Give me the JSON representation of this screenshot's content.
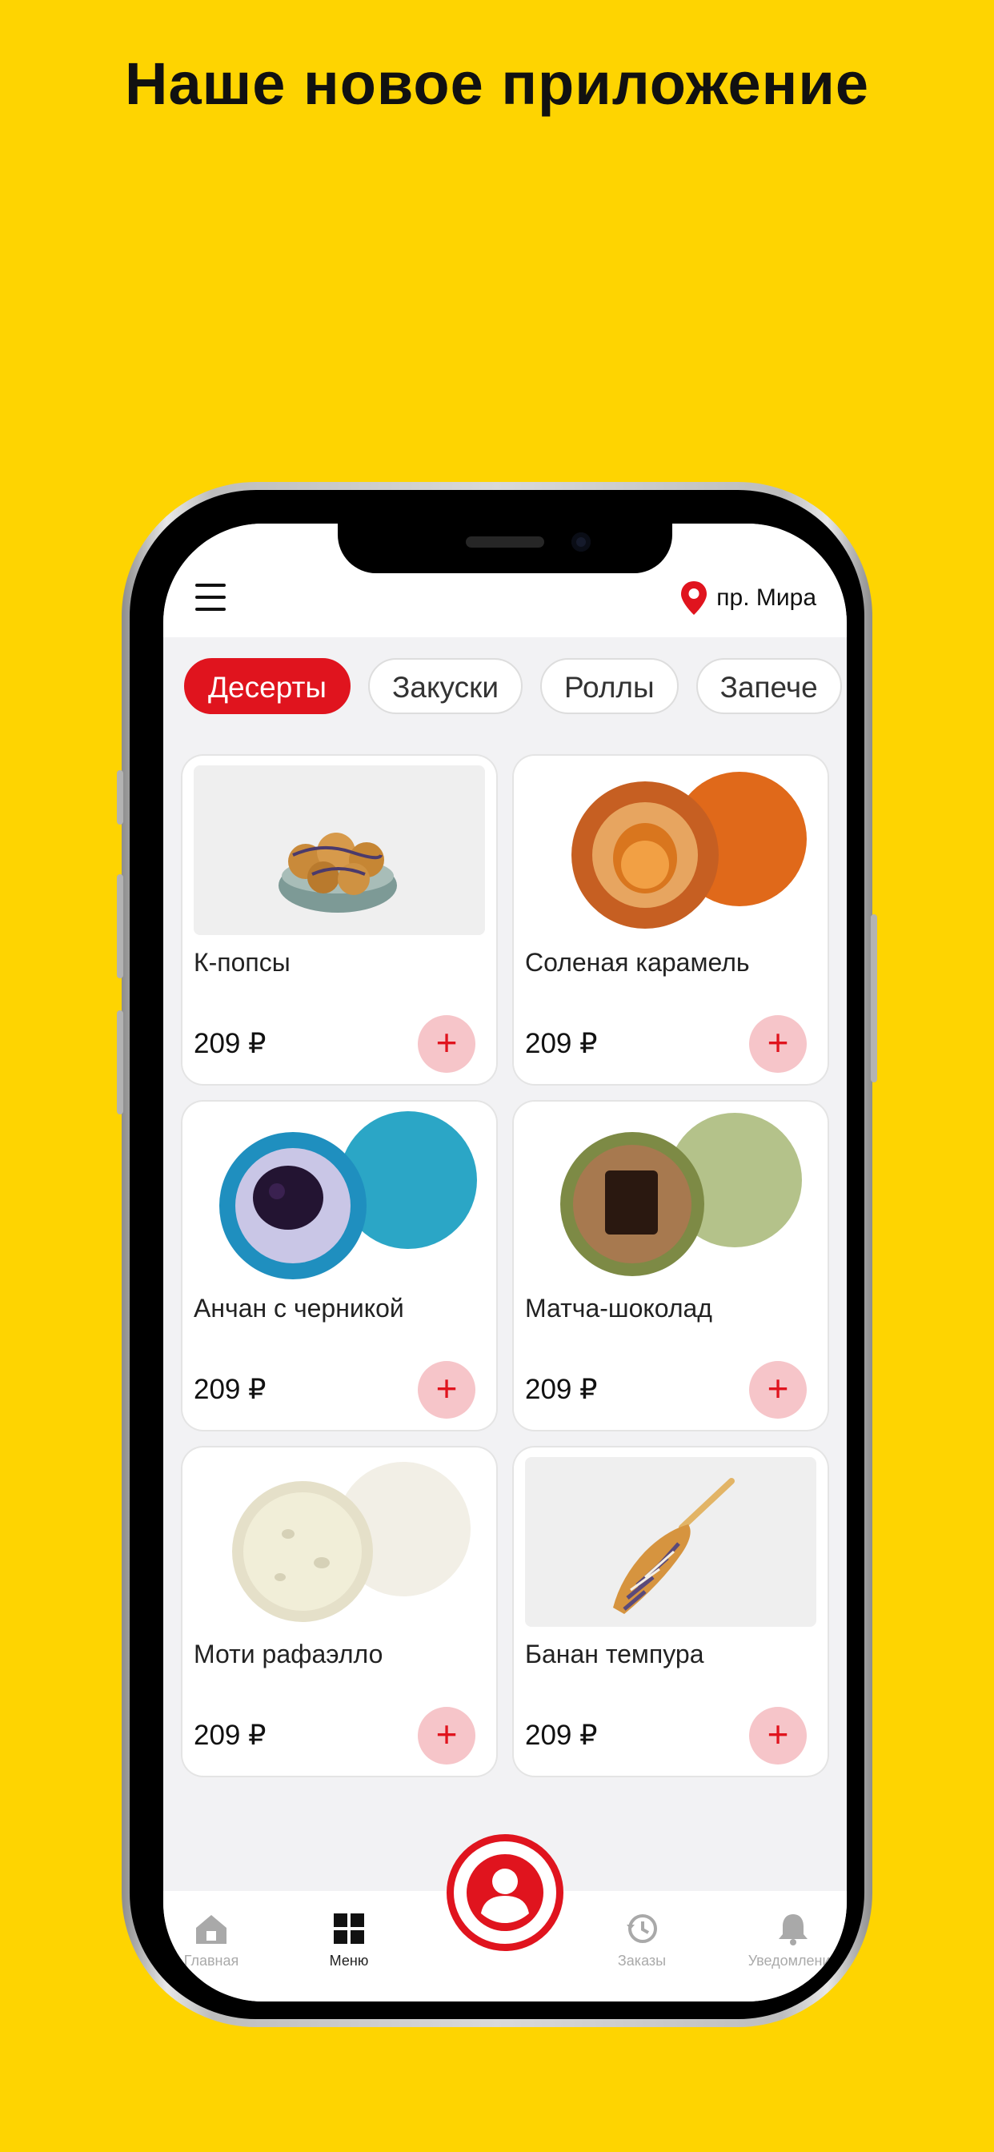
{
  "headline": "Наше новое приложение",
  "header": {
    "location": "пр. Мира"
  },
  "categories": [
    "Десерты",
    "Закуски",
    "Роллы",
    "Запече"
  ],
  "active_category": "Десерты",
  "products": [
    {
      "name": "К-попсы",
      "price": "209 ₽",
      "add": "+"
    },
    {
      "name": "Соленая карамель",
      "price": "209 ₽",
      "add": "+"
    },
    {
      "name": "Анчан с черникой",
      "price": "209 ₽",
      "add": "+"
    },
    {
      "name": "Матча-шоколад",
      "price": "209 ₽",
      "add": "+"
    },
    {
      "name": "Моти рафаэлло",
      "price": "209 ₽",
      "add": "+"
    },
    {
      "name": "Банан темпура",
      "price": "209 ₽",
      "add": "+"
    }
  ],
  "tabbar": {
    "items": [
      {
        "label": "Главная",
        "icon": "home-icon"
      },
      {
        "label": "Меню",
        "icon": "menu-grid-icon"
      },
      {
        "label": "Заказы",
        "icon": "history-icon"
      },
      {
        "label": "Уведомления",
        "icon": "bell-icon"
      }
    ],
    "active": "Меню",
    "center_icon": "profile-icon"
  },
  "colors": {
    "background": "#FED401",
    "accent": "#E0141E",
    "add_button_bg": "#F6C5C9"
  }
}
